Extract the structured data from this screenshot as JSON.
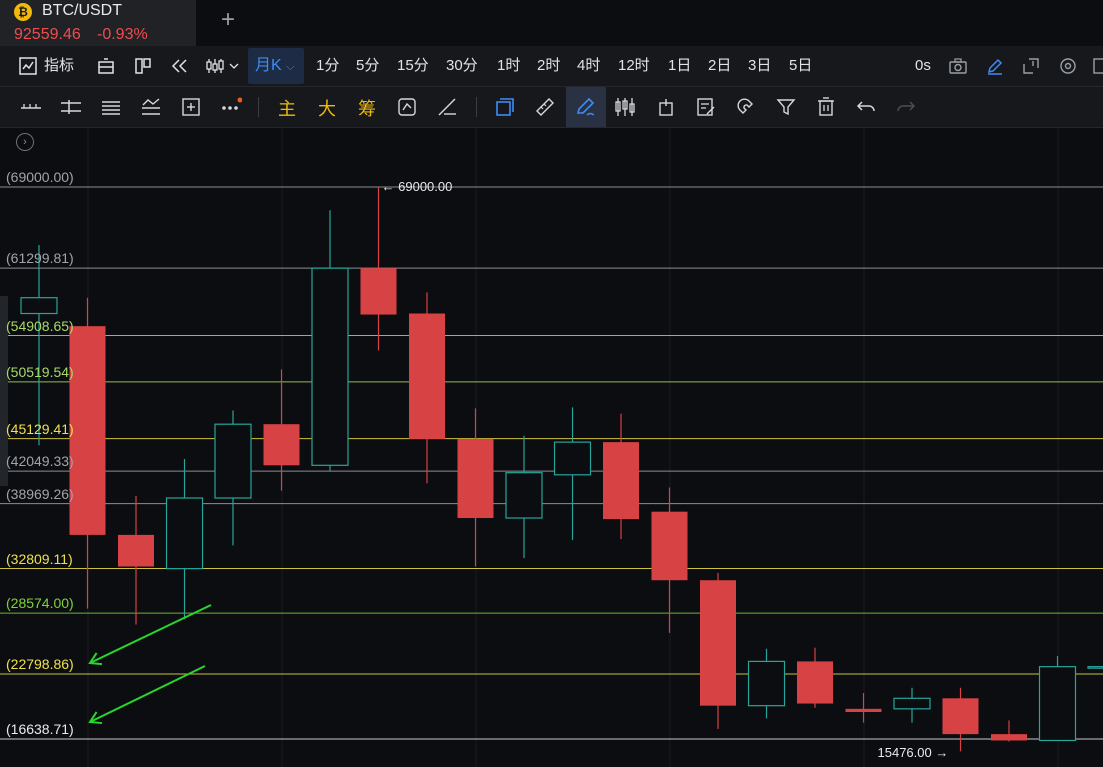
{
  "tab": {
    "coin_icon": "bitcoin-icon",
    "symbol": "BTC/USDT",
    "price": "92559.46",
    "change": "-0.93%",
    "add_label": "+"
  },
  "toolbar1": {
    "indicators_label": "指标",
    "active_period": "月K",
    "periods": [
      "1分",
      "5分",
      "15分",
      "30分",
      "1时",
      "2时",
      "4时",
      "12时",
      "1日",
      "2日",
      "3日",
      "5日"
    ],
    "countdown": "0s"
  },
  "toolbar2": {
    "main_label": "主",
    "big_label": "大",
    "chip_label": "筹"
  },
  "chart_data": {
    "type": "candlestick",
    "price_levels": [
      {
        "label": "(69000.00)",
        "value": 69000.0,
        "color": "#a0a4ab"
      },
      {
        "label": "(61299.81)",
        "value": 61299.81,
        "color": "#a0a4ab"
      },
      {
        "label": "(54908.65)",
        "value": 54908.65,
        "color": "#a8d96a"
      },
      {
        "label": "(50519.54)",
        "value": 50519.54,
        "color": "#a8d96a"
      },
      {
        "label": "(45129.41)",
        "value": 45129.41,
        "color": "#f0e04a"
      },
      {
        "label": "(42049.33)",
        "value": 42049.33,
        "color": "#a0a4ab"
      },
      {
        "label": "(38969.26)",
        "value": 38969.26,
        "color": "#a0a4ab"
      },
      {
        "label": "(32809.11)",
        "value": 32809.11,
        "color": "#f0e04a"
      },
      {
        "label": "(28574.00)",
        "value": 28574.0,
        "color": "#7ed33c"
      },
      {
        "label": "(22798.86)",
        "value": 22798.86,
        "color": "#f0e04a"
      },
      {
        "label": "(16638.71)",
        "value": 16638.71,
        "color": "#e8eaed"
      }
    ],
    "high_label": "69000.00",
    "low_label": "15476.00",
    "candles": [
      {
        "o": 57000,
        "h": 63500,
        "l": 44500,
        "c": 58500
      },
      {
        "o": 55800,
        "h": 58500,
        "l": 29000,
        "c": 36000
      },
      {
        "o": 36000,
        "h": 39700,
        "l": 27500,
        "c": 33000
      },
      {
        "o": 32800,
        "h": 43200,
        "l": 28000,
        "c": 39500
      },
      {
        "o": 39500,
        "h": 47800,
        "l": 35000,
        "c": 46500
      },
      {
        "o": 46500,
        "h": 51700,
        "l": 40200,
        "c": 42600
      },
      {
        "o": 42600,
        "h": 66800,
        "l": 42100,
        "c": 61300
      },
      {
        "o": 61300,
        "h": 69000,
        "l": 53500,
        "c": 56900
      },
      {
        "o": 57000,
        "h": 59000,
        "l": 40900,
        "c": 45100
      },
      {
        "o": 45100,
        "h": 48000,
        "l": 33000,
        "c": 37600
      },
      {
        "o": 37600,
        "h": 45400,
        "l": 33800,
        "c": 41900
      },
      {
        "o": 41700,
        "h": 48100,
        "l": 35500,
        "c": 44800
      },
      {
        "o": 44800,
        "h": 47500,
        "l": 35600,
        "c": 37500
      },
      {
        "o": 38200,
        "h": 40500,
        "l": 26700,
        "c": 31700
      },
      {
        "o": 31700,
        "h": 32400,
        "l": 17600,
        "c": 19800
      },
      {
        "o": 19800,
        "h": 25200,
        "l": 18600,
        "c": 24000
      },
      {
        "o": 24000,
        "h": 25300,
        "l": 19600,
        "c": 20000
      },
      {
        "o": 19500,
        "h": 21000,
        "l": 18200,
        "c": 19200
      },
      {
        "o": 19500,
        "h": 21500,
        "l": 18200,
        "c": 20500
      },
      {
        "o": 20500,
        "h": 21500,
        "l": 15476,
        "c": 17100
      },
      {
        "o": 17100,
        "h": 18400,
        "l": 16400,
        "c": 16500
      },
      {
        "o": 16500,
        "h": 24500,
        "l": 16500,
        "c": 23500
      },
      {
        "o": 23500,
        "h": 23600,
        "l": 23400,
        "c": 23500
      }
    ],
    "up_color": "#26a69a",
    "down_color": "#d74244",
    "annotation_color": "#29d52d"
  }
}
